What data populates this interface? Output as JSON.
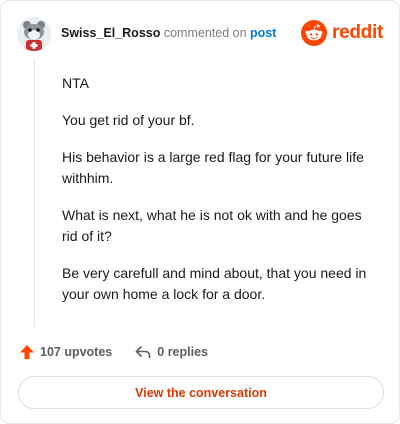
{
  "header": {
    "username": "Swiss_El_Rosso",
    "commented_text": "commented on",
    "post_link": "post",
    "brand": "reddit"
  },
  "comment": {
    "paragraphs": [
      "NTA",
      "You get rid of your bf.",
      "His behavior is a large red flag for your future life withhim.",
      "What is next, what he is not ok with and he goes rid of it?",
      "Be very carefull and mind about, that you need in your own home a lock for a door."
    ]
  },
  "actions": {
    "upvotes": "107 upvotes",
    "replies": "0 replies"
  },
  "cta": {
    "label": "View the conversation"
  },
  "colors": {
    "accent": "#ff4500",
    "link": "#0079d3",
    "cta_text": "#d93a00"
  }
}
